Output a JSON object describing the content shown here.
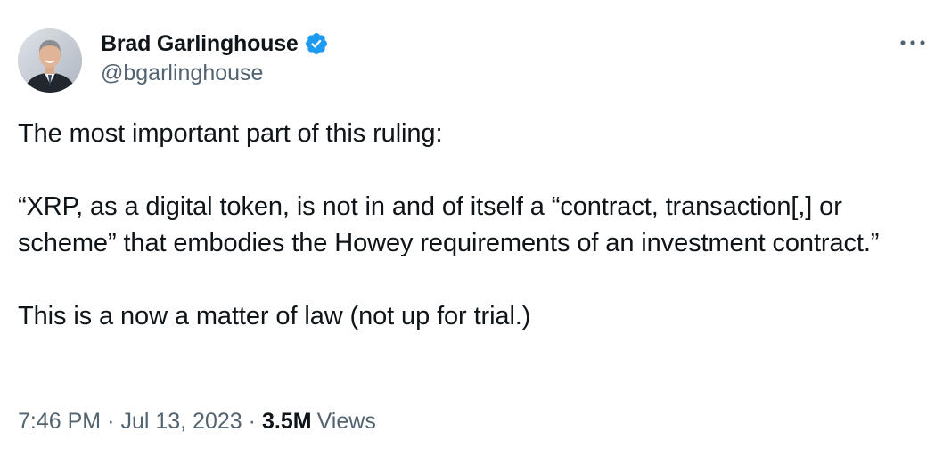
{
  "author": {
    "name": "Brad Garlinghouse",
    "handle": "@bgarlinghouse",
    "verified_color": "#1d9bf0",
    "avatar_icon": "profile-photo"
  },
  "tweet": {
    "paragraphs": [
      "The most important part of this ruling:",
      "“XRP, as a digital token, is not in and of itself a “contract, transaction[,] or scheme” that embodies the Howey requirements of an investment contract.”",
      "This is a now a matter of law (not up for trial.)"
    ]
  },
  "meta": {
    "time": "7:46 PM",
    "date": "Jul 13, 2023",
    "separator": "·",
    "views_count": "3.5M",
    "views_label": "Views"
  },
  "colors": {
    "text": "#0f1419",
    "secondary": "#536471",
    "accent": "#1d9bf0"
  }
}
